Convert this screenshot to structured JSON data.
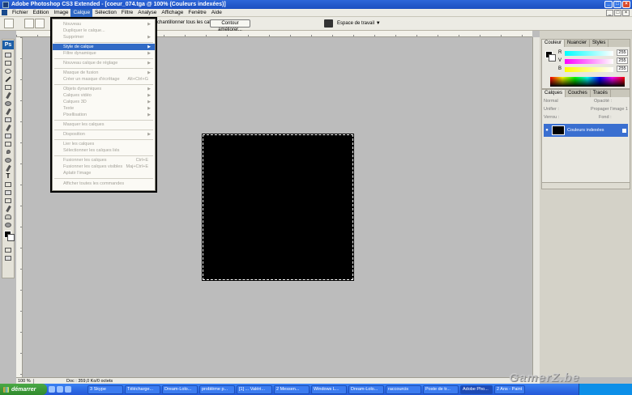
{
  "window": {
    "title": "Adobe Photoshop CS3 Extended - [coeur_074.tga @ 100% (Couleurs indexées)]"
  },
  "menubar": {
    "items": [
      "Fichier",
      "Edition",
      "Image",
      "Calque",
      "Sélection",
      "Filtre",
      "Analyse",
      "Affichage",
      "Fenêtre",
      "Aide"
    ],
    "active": "Calque"
  },
  "options_bar": {
    "sample_all_label": "Échantillonner tous les calques",
    "contour_button": "Contour améliorer...",
    "workspace_button": "Espace de travail ▼"
  },
  "dropdown": {
    "items": [
      {
        "label": "Nouveau",
        "enabled": false,
        "submenu": true
      },
      {
        "label": "Dupliquer le calque...",
        "enabled": false
      },
      {
        "label": "Supprimer",
        "enabled": false,
        "submenu": true
      },
      {
        "label": "Style de calque",
        "enabled": false,
        "submenu": true,
        "highlight": true
      },
      {
        "label": "Filtre dynamique",
        "enabled": false,
        "submenu": true
      },
      {
        "label": "Nouveau calque de réglage",
        "enabled": false,
        "submenu": true
      },
      {
        "label": "Masque de fusion",
        "enabled": false,
        "submenu": true
      },
      {
        "label": "Créer un masque d'écrêtage",
        "enabled": false,
        "shortcut": "Alt+Ctrl+G"
      },
      {
        "label": "Objets dynamiques",
        "enabled": false,
        "submenu": true
      },
      {
        "label": "Calques vidéo",
        "enabled": false,
        "submenu": true
      },
      {
        "label": "Calques 3D",
        "enabled": false,
        "submenu": true
      },
      {
        "label": "Texte",
        "enabled": false,
        "submenu": true
      },
      {
        "label": "Pixellisation",
        "enabled": false,
        "submenu": true
      },
      {
        "label": "Masquer les calques",
        "enabled": false
      },
      {
        "label": "Disposition",
        "enabled": false,
        "submenu": true
      },
      {
        "label": "Lier les calques",
        "enabled": false
      },
      {
        "label": "Sélectionner les calques liés",
        "enabled": false
      },
      {
        "label": "Fusionner les calques",
        "enabled": false,
        "shortcut": "Ctrl+E"
      },
      {
        "label": "Fusionner les calques visibles",
        "enabled": false,
        "shortcut": "Maj+Ctrl+E"
      },
      {
        "label": "Aplatir l'image",
        "enabled": false
      },
      {
        "label": "Afficher toutes les commandes",
        "enabled": false
      }
    ]
  },
  "color_panel": {
    "tabs": [
      "Couleur",
      "Nuancier",
      "Styles"
    ],
    "channels": [
      {
        "label": "R",
        "value": "255"
      },
      {
        "label": "V",
        "value": "255"
      },
      {
        "label": "B",
        "value": "255"
      }
    ]
  },
  "layers_panel": {
    "tabs": [
      "Calques",
      "Couches",
      "Tracés"
    ],
    "blend_mode": "Normal",
    "opacity_label": "Opacité :",
    "unify_label": "Unifier :",
    "propagate_label": "Propager l'image 1",
    "lock_label": "Verrou :",
    "fill_label": "Fond :",
    "layer_name": "Couleurs indexées"
  },
  "status_bar": {
    "zoom": "100 %",
    "doc": "Doc : 359,0 Ko/0 octets"
  },
  "taskbar": {
    "start": "démarrer",
    "tasks": [
      "3 Skype",
      "Télécharge...",
      "Dream-Lolo...",
      "problème p...",
      "[1] ... Valéri...",
      "2 Messen...",
      "Windows L...",
      "Dream-Lolo...",
      "raccourcis",
      "Poste de tr...",
      "Adobe Pho...",
      "2 Ans - Paint"
    ]
  },
  "watermark": "GamerZ.be"
}
